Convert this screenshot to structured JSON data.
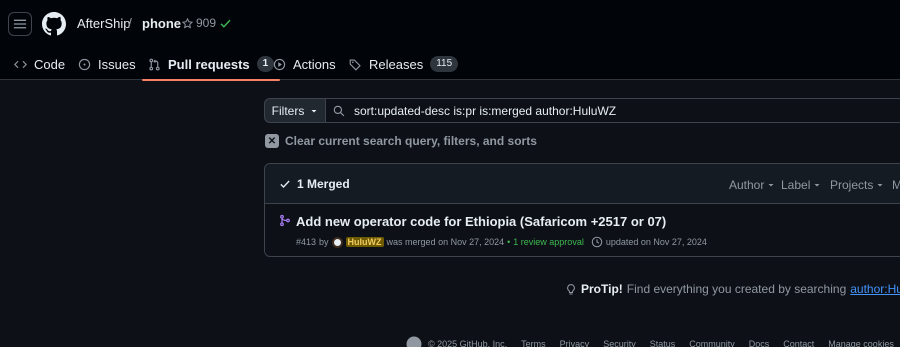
{
  "header": {
    "owner": "AfterShip",
    "separator": "/",
    "repo": "phone",
    "star_count": "909"
  },
  "nav": {
    "tabs": [
      {
        "label": "Code",
        "icon": "code-icon"
      },
      {
        "label": "Issues",
        "icon": "issue-opened-icon"
      },
      {
        "label": "Pull requests",
        "icon": "git-pull-request-icon",
        "count": "1",
        "active": true
      },
      {
        "label": "Actions",
        "icon": "play-icon"
      },
      {
        "label": "Releases",
        "icon": "tag-icon",
        "count": "115"
      }
    ]
  },
  "search": {
    "filters_label": "Filters",
    "query": "sort:updated-desc is:pr is:merged author:HuluWZ",
    "clear_label": "Clear current search query, filters, and sorts"
  },
  "results": {
    "merged_label": "1 Merged",
    "sort_links": [
      "Author",
      "Label",
      "Projects",
      "M"
    ],
    "items": [
      {
        "title": "Add new operator code for Ethiopia (Safaricom +2517 or 07)",
        "number": "#413",
        "by": "by",
        "author": "HuluWZ",
        "merged_text": "was merged on Nov 27, 2024",
        "bullet": "•",
        "review": "1 review approval",
        "updated": "updated on Nov 27, 2024"
      }
    ]
  },
  "protip": {
    "label": "ProTip!",
    "text": "Find everything you created by searching",
    "link": "author:HuluWZ",
    "end": "."
  },
  "footer": {
    "copyright": "© 2025 GitHub, Inc.",
    "links": [
      "Terms",
      "Privacy",
      "Security",
      "Status",
      "Community",
      "Docs",
      "Contact",
      "Manage cookies"
    ]
  },
  "colors": {
    "accent_underline": "#f78166",
    "merged_purple": "#ab7df8",
    "success_green": "#3fb950",
    "link_blue": "#4493f8"
  }
}
